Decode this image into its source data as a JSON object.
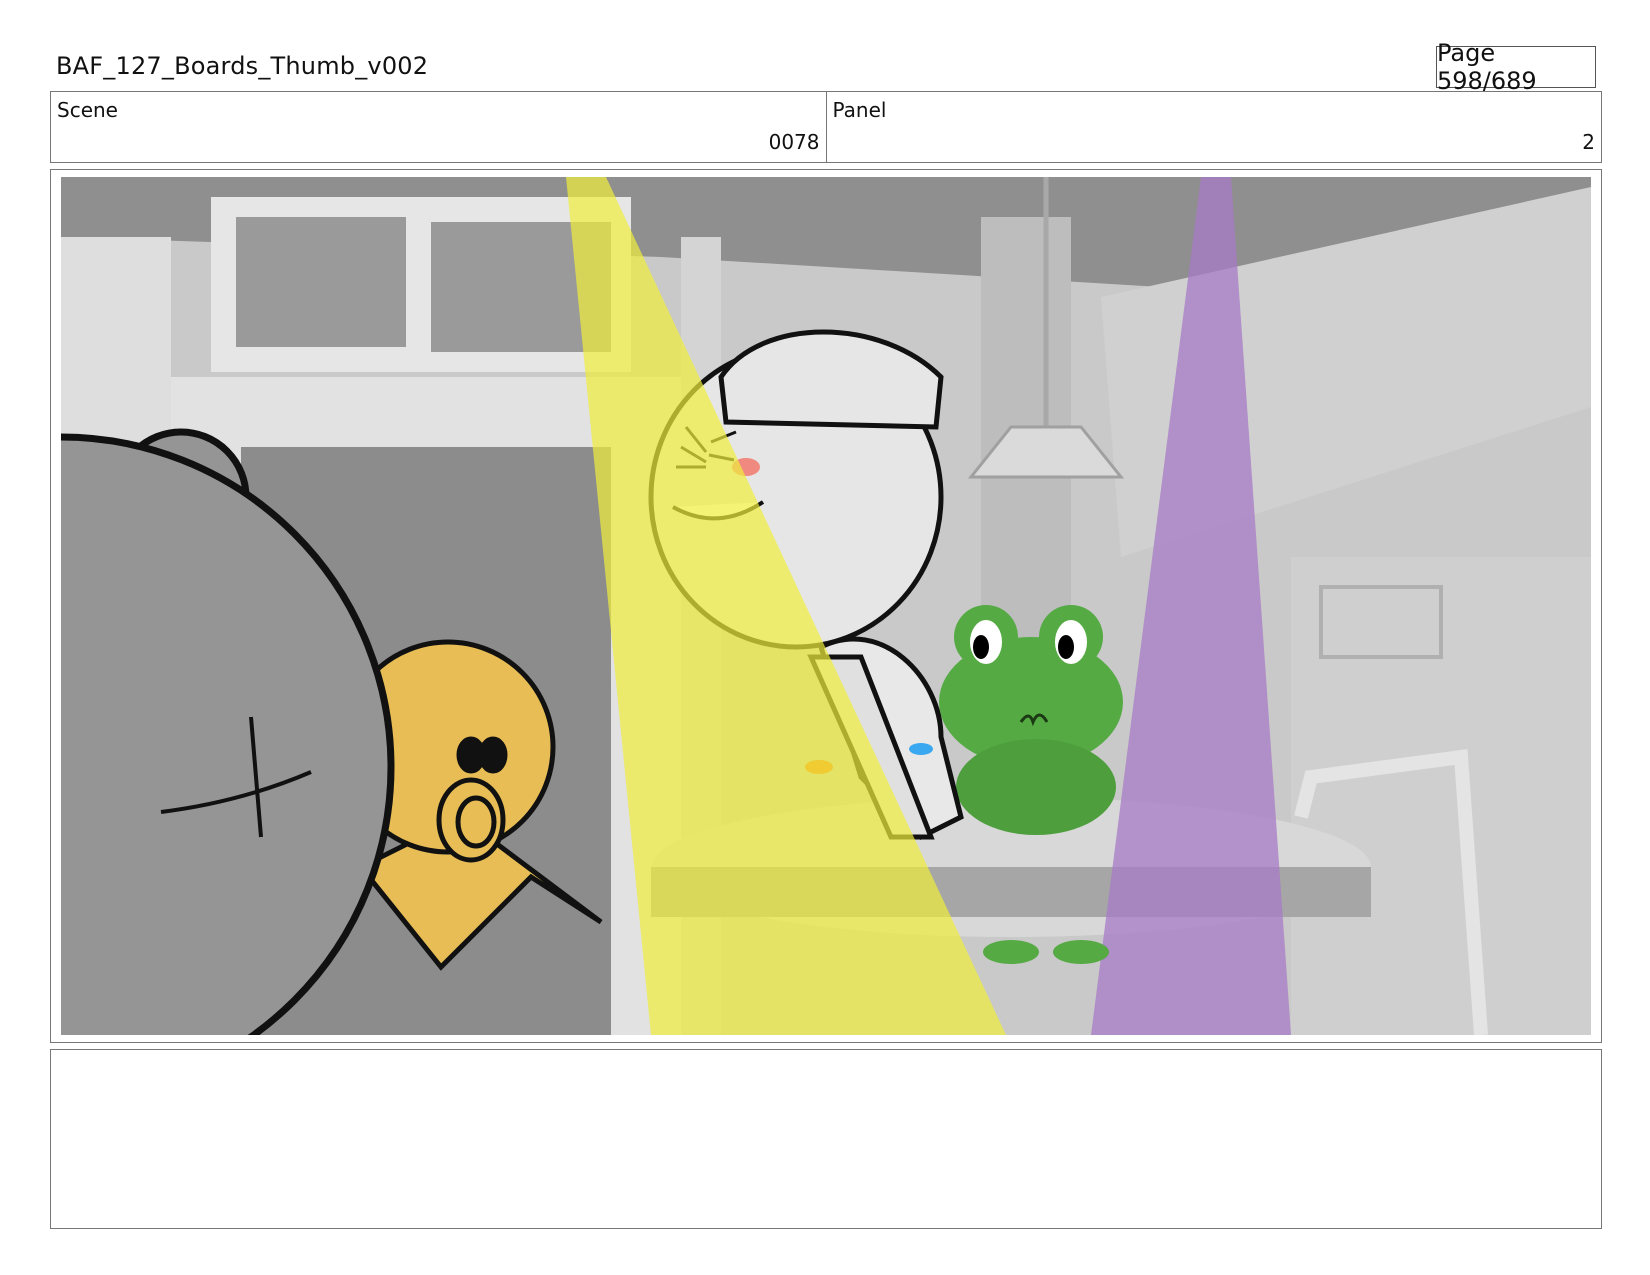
{
  "header": {
    "title": "BAF_127_Boards_Thumb_v002",
    "page": "Page 598/689"
  },
  "info": {
    "scene_label": "Scene",
    "scene_value": "0078",
    "panel_label": "Panel",
    "panel_value": "2"
  },
  "colors": {
    "spotlight_yellow": "#f0ee3c",
    "spotlight_purple": "#a77ac7",
    "frog_green": "#55aa44",
    "duck_orange": "#e8bd55",
    "room_gray": "#c8c8c8"
  },
  "notes": {
    "text": ""
  }
}
